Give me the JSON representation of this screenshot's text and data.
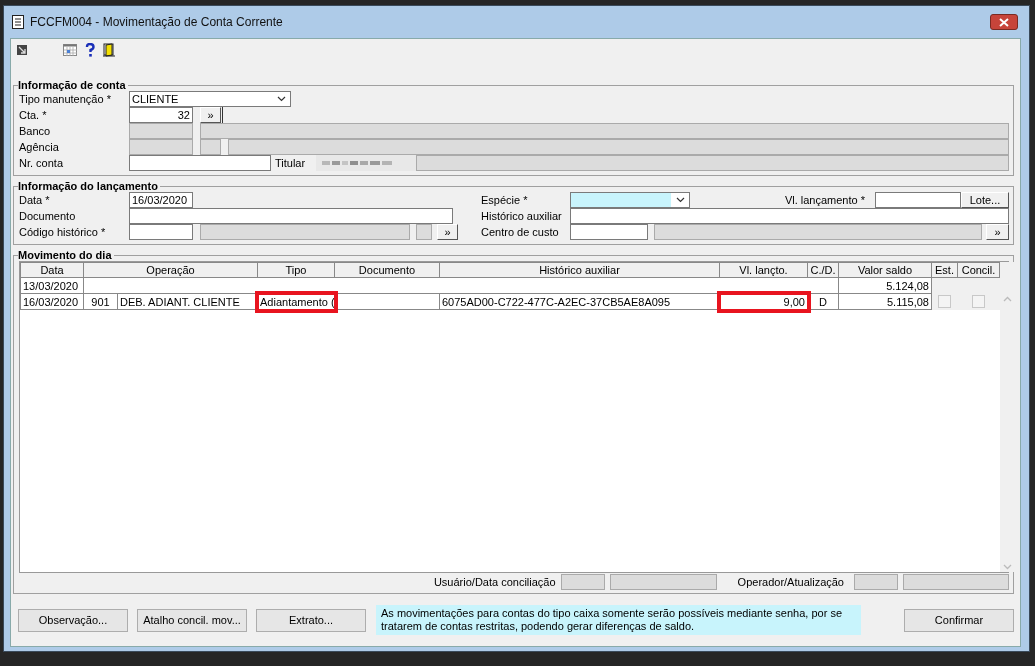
{
  "window": {
    "title": "FCCFM004 - Movimentação de Conta Corrente"
  },
  "account_section": {
    "title": "Informação de conta",
    "tipo_manutencao": {
      "label": "Tipo manutenção *",
      "value": "CLIENTE"
    },
    "cta": {
      "label": "Cta. *",
      "value": "32",
      "button": "»"
    },
    "banco": {
      "label": "Banco"
    },
    "agencia": {
      "label": "Agência"
    },
    "nr_conta": {
      "label": "Nr. conta"
    },
    "titular": {
      "label": "Titular"
    }
  },
  "entry_section": {
    "title": "Informação do lançamento",
    "data": {
      "label": "Data *",
      "value": "16/03/2020"
    },
    "documento": {
      "label": "Documento"
    },
    "codigo_historico": {
      "label": "Código histórico *",
      "button": "»"
    },
    "especie": {
      "label": "Espécie *"
    },
    "vl_lancamento": {
      "label": "Vl. lançamento *",
      "button": "Lote..."
    },
    "historico_auxiliar": {
      "label": "Histórico auxiliar"
    },
    "centro_custo": {
      "label": "Centro de custo",
      "button": "»"
    }
  },
  "movements": {
    "title": "Movimento do dia",
    "columns": [
      "Data",
      "Operação",
      "Tipo",
      "Documento",
      "Histórico auxiliar",
      "Vl. lançto.",
      "C./D.",
      "Valor saldo",
      "Est.",
      "Concil."
    ],
    "rows": [
      {
        "kind": "balance",
        "data": "13/03/2020",
        "saldo": "5.124,08"
      },
      {
        "kind": "entry",
        "cells": [
          {
            "text": "16/03/2020",
            "highlighted": false
          },
          {
            "text": "901",
            "highlighted": false
          },
          {
            "text": "DEB. ADIANT. CLIENTE",
            "highlighted": false
          },
          {
            "text": "Adiantamento (",
            "highlighted": true
          },
          {
            "highlighted": false
          },
          {
            "text": "6075AD00-C722-477C-A2EC-37CB5AE8A095",
            "highlighted": false
          },
          {
            "text": "9,00",
            "highlighted": true
          },
          {
            "text": "D",
            "highlighted": false
          },
          {
            "text": "5.115,08",
            "highlighted": false
          }
        ],
        "est_checked": false,
        "concil_checked": false
      }
    ],
    "conciliacao_label": "Usuário/Data conciliação",
    "atualizacao_label": "Operador/Atualização"
  },
  "actions": [
    "Observação...",
    "Atalho concil. mov...",
    "Extrato..."
  ],
  "message": "As movimentações para contas do tipo caixa somente serão possíveis mediante senha, por se tratarem de contas restritas, podendo gerar diferenças de saldo.",
  "confirm_button": "Confirmar"
}
